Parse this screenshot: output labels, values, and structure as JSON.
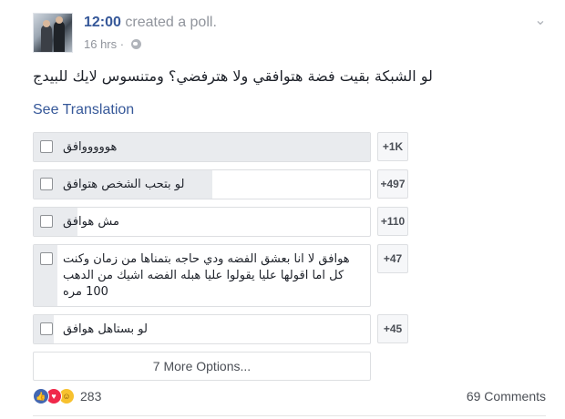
{
  "post": {
    "author": "12:00",
    "action": "created a poll.",
    "time": "16 hrs",
    "privacy_icon": "globe-icon",
    "menu_icon": "chevron-down-icon",
    "text": "لو الشبكة بقيت فضة هتوافقي ولا هترفضي؟ ومتنسوس لايك للبيدج",
    "see_translation": "See Translation"
  },
  "poll": {
    "options": [
      {
        "label": "هوووووافق",
        "count": "+1K",
        "fill": 1.0
      },
      {
        "label": "لو بتحب الشخص هتوافق",
        "count": "+497",
        "fill": 0.53
      },
      {
        "label": "مش هوافق",
        "count": "+110",
        "fill": 0.13
      },
      {
        "label": "هوافق لا انا بعشق الفضه ودي حاجه بتمناها من زمان وكنت كل اما اقولها عليا يقولوا عليا هبله الفضه اشيك من الدهب 100 مره",
        "count": "+47",
        "fill": 0.07
      },
      {
        "label": "لو بستاهل هوافق",
        "count": "+45",
        "fill": 0.06
      }
    ],
    "more_options": "7 More Options..."
  },
  "footer": {
    "reaction_icons": [
      "like-icon",
      "love-icon",
      "haha-icon"
    ],
    "reaction_count": "283",
    "comments": "69 Comments"
  },
  "colors": {
    "link": "#365899",
    "muted": "#90949c",
    "border": "#dddfe2",
    "bar": "#e9ebee",
    "like": "#4267b2",
    "love": "#f0284a",
    "haha": "#f7c12e"
  }
}
